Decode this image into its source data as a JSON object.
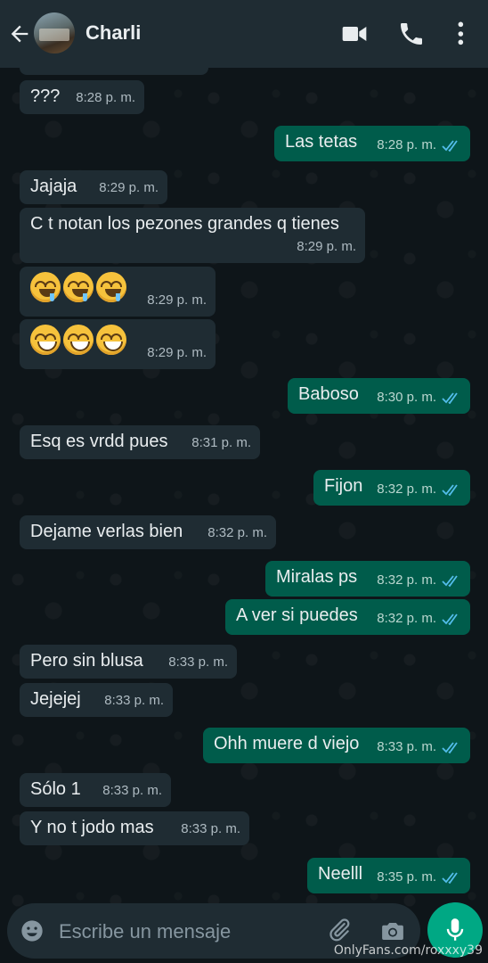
{
  "header": {
    "contact_name": "Charli"
  },
  "messages": [
    {
      "text": "???",
      "time": "8:28 p. m."
    },
    {
      "text": "Las tetas",
      "time": "8:28 p. m."
    },
    {
      "text": "Jajaja",
      "time": "8:29 p. m."
    },
    {
      "text": "C t notan los pezones grandes q tienes",
      "time": "8:29 p. m."
    },
    {
      "text": "",
      "emoji": "drooling-face x3",
      "time": "8:29 p. m."
    },
    {
      "text": "",
      "emoji": "grinning-face x3",
      "time": "8:29 p. m."
    },
    {
      "text": "Baboso",
      "time": "8:30 p. m."
    },
    {
      "text": "Esq es vrdd pues",
      "time": "8:31 p. m."
    },
    {
      "text": "Fijon",
      "time": "8:32 p. m."
    },
    {
      "text": "Dejame verlas bien",
      "time": "8:32 p. m."
    },
    {
      "text": "Miralas ps",
      "time": "8:32 p. m."
    },
    {
      "text": "A ver si puedes",
      "time": "8:32 p. m."
    },
    {
      "text": "Pero sin blusa",
      "time": "8:33 p. m."
    },
    {
      "text": "Jejejej",
      "time": "8:33 p. m."
    },
    {
      "text": "Ohh muere d viejo",
      "time": "8:33 p. m."
    },
    {
      "text": "Sólo 1",
      "time": "8:33 p. m."
    },
    {
      "text": "Y no t jodo mas",
      "time": "8:33 p. m."
    },
    {
      "text": "Neelll",
      "time": "8:35 p. m."
    }
  ],
  "input": {
    "placeholder": "Escribe un mensaje"
  },
  "watermark": "OnlyFans.com/roxxxy39",
  "colors": {
    "header_bg": "#1f2c33",
    "incoming_bubble": "#1f2c33",
    "outgoing_bubble": "#005c4b",
    "read_ticks": "#53bdeb",
    "mic_button": "#00a884"
  },
  "icons": [
    "back-arrow-icon",
    "video-call-icon",
    "phone-icon",
    "more-vert-icon",
    "emoji-icon",
    "attach-icon",
    "camera-icon",
    "mic-icon",
    "read-ticks-icon"
  ]
}
